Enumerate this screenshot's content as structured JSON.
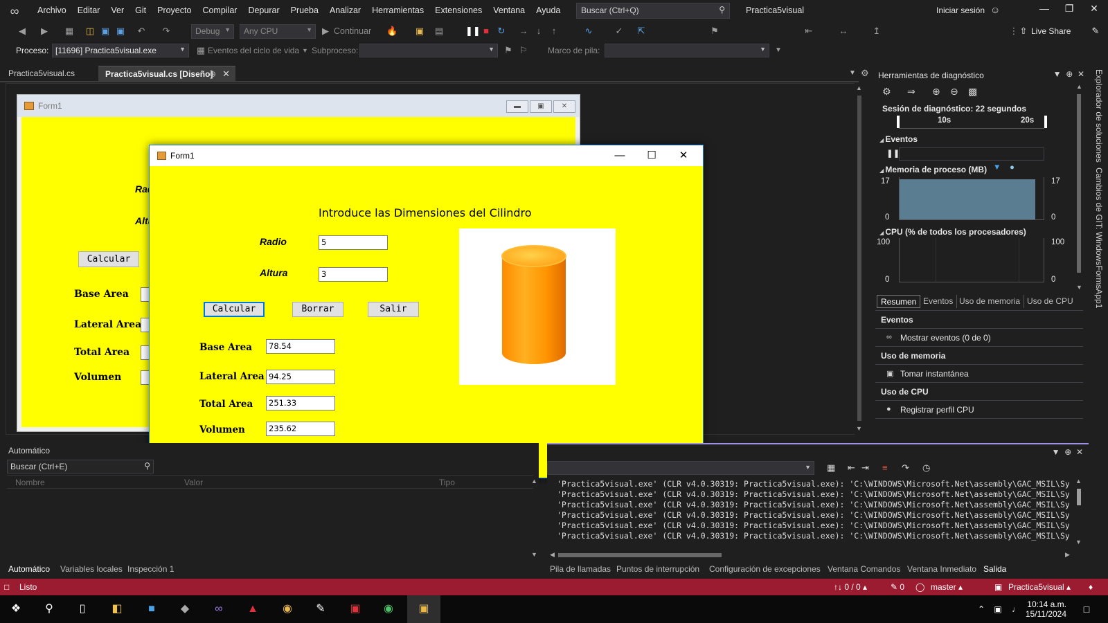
{
  "menubar": {
    "items": [
      "Archivo",
      "Editar",
      "Ver",
      "Git",
      "Proyecto",
      "Compilar",
      "Depurar",
      "Prueba",
      "Analizar",
      "Herramientas",
      "Extensiones",
      "Ventana",
      "Ayuda"
    ],
    "search_placeholder": "Buscar (Ctrl+Q)",
    "project_title": "Practica5visual",
    "signin": "Iniciar sesión"
  },
  "toolbar": {
    "config": "Debug",
    "platform": "Any CPU",
    "continue_label": "Continuar",
    "liveshare": "Live Share"
  },
  "procbar": {
    "process_label": "Proceso:",
    "process_value": "[11696] Practica5visual.exe",
    "lifecycle": "Eventos del ciclo de vida",
    "thread_label": "Subproceso:",
    "stack_label": "Marco de pila:"
  },
  "doc_tabs": {
    "tab1": "Practica5visual.cs",
    "tab2": "Practica5visual.cs [Diseño]"
  },
  "design_form": {
    "title": "Form1",
    "radio": "Rad",
    "altura": "Altur",
    "calcular": "Calcular",
    "base_area": "Base Area",
    "lateral_area": "Lateral Area",
    "total_area": "Total Area",
    "volumen": "Volumen"
  },
  "form1": {
    "title": "Form1",
    "heading": "Introduce las Dimensiones del Cilindro",
    "radio_label": "Radio",
    "radio_value": "5",
    "altura_label": "Altura",
    "altura_value": "3",
    "btn_calcular": "Calcular",
    "btn_borrar": "Borrar",
    "btn_salir": "Salir",
    "base_area_label": "Base Area",
    "base_area_value": "78.54",
    "lateral_area_label": "Lateral Area",
    "lateral_area_value": "94.25",
    "total_area_label": "Total Area",
    "total_area_value": "251.33",
    "volumen_label": "Volumen",
    "volumen_value": "235.62",
    "cylinder_color": "#ff9c10"
  },
  "diagnostics": {
    "title": "Herramientas de diagnóstico",
    "session": "Sesión de diagnóstico: 22 segundos",
    "tl_10": "10s",
    "tl_20": "20s",
    "events": "Eventos",
    "memory": "Memoria de proceso (MB)",
    "mem_max": "17",
    "mem_min": "0",
    "cpu": "CPU (% de todos los procesadores)",
    "cpu_max": "100",
    "cpu_min": "0",
    "tabs": [
      "Resumen",
      "Eventos",
      "Uso de memoria",
      "Uso de CPU"
    ],
    "sec_events": "Eventos",
    "show_events": "Mostrar eventos (0 de 0)",
    "sec_memory": "Uso de memoria",
    "snapshot": "Tomar instantánea",
    "sec_cpu": "Uso de CPU",
    "cpu_profile": "Registrar perfil CPU",
    "memory_fill": 0.95,
    "memory_color": "#5b7d92"
  },
  "side": {
    "solution_explorer": "Explorador de soluciones",
    "git_changes": "Cambios de GIT: WindowsFormsApp1"
  },
  "auto_panel": {
    "title": "Automático",
    "search": "Buscar (Ctrl+E)",
    "col_name": "Nombre",
    "col_value": "Valor",
    "col_type": "Tipo"
  },
  "bottom_tabs_left": [
    "Automático",
    "Variables locales",
    "Inspección 1"
  ],
  "bottom_tabs_right": [
    "Pila de llamadas",
    "Puntos de interrupción",
    "Configuración de excepciones",
    "Ventana Comandos",
    "Ventana Inmediato",
    "Salida"
  ],
  "output": {
    "lines": [
      "'Practica5visual.exe' (CLR v4.0.30319: Practica5visual.exe): 'C:\\WINDOWS\\Microsoft.Net\\assembly\\GAC_MSIL\\Sy",
      "'Practica5visual.exe' (CLR v4.0.30319: Practica5visual.exe): 'C:\\WINDOWS\\Microsoft.Net\\assembly\\GAC_MSIL\\Sy",
      "'Practica5visual.exe' (CLR v4.0.30319: Practica5visual.exe): 'C:\\WINDOWS\\Microsoft.Net\\assembly\\GAC_MSIL\\Sy",
      "'Practica5visual.exe' (CLR v4.0.30319: Practica5visual.exe): 'C:\\WINDOWS\\Microsoft.Net\\assembly\\GAC_MSIL\\Sy",
      "'Practica5visual.exe' (CLR v4.0.30319: Practica5visual.exe): 'C:\\WINDOWS\\Microsoft.Net\\assembly\\GAC_MSIL\\Sy",
      "'Practica5visual.exe' (CLR v4.0.30319: Practica5visual.exe): 'C:\\WINDOWS\\Microsoft.Net\\assembly\\GAC_MSIL\\Sy"
    ]
  },
  "statusbar": {
    "ready": "Listo",
    "changes": "↑↓ 0 / 0 ▴",
    "edits": "✎ 0",
    "branch": "master ▴",
    "repo": "Practica5visual ▴",
    "color": "#9b1b30"
  },
  "taskbar": {
    "time": "10:14 a.m.",
    "date": "15/11/2024"
  }
}
